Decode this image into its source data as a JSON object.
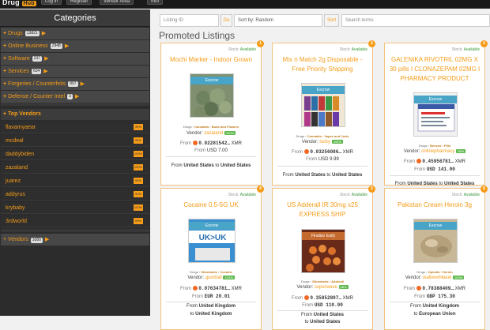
{
  "topbar": {
    "logo": "Drug",
    "logo_box": "Hub",
    "buttons": [
      "Log in",
      "Register",
      "Vendor Area",
      "Info"
    ]
  },
  "sidebar": {
    "title": "Categories",
    "categories": [
      {
        "label": "Drugs",
        "count": "13821"
      },
      {
        "label": "Online Business",
        "count": "2948"
      },
      {
        "label": "Software",
        "count": "237"
      },
      {
        "label": "Services",
        "count": "634"
      },
      {
        "label": "Forgeries / Counterfeits",
        "count": "897"
      },
      {
        "label": "Defense / Counter Intel",
        "count": "3"
      }
    ],
    "top_vendors_title": "Top Vendors",
    "vendors": [
      {
        "name": "flavamyaear",
        "pct": "99%"
      },
      {
        "name": "mcdeal",
        "pct": "98%"
      },
      {
        "name": "daddybiden",
        "pct": "100%"
      },
      {
        "name": "zazaland",
        "pct": "100%"
      },
      {
        "name": "juarez",
        "pct": "99%"
      },
      {
        "name": "addyrus",
        "pct": "99%"
      },
      {
        "name": "krybaby",
        "pct": "100%"
      },
      {
        "name": "3rdworld",
        "pct": "99%"
      }
    ],
    "vendors_row": {
      "label": "Vendors",
      "count": "1080"
    }
  },
  "search": {
    "listing_id_placeholder": "Listing ID",
    "go_label": "Go",
    "sort_label": "Sort by: Random",
    "sort_button": "Sort",
    "terms_placeholder": "Search terms"
  },
  "promoted_title": "Promoted Listings",
  "listings": [
    {
      "badge": "1",
      "stock": "Stock:",
      "available": "Available",
      "title": "Mochi Marker - Indoor Grown",
      "escrow": "Escrow",
      "crumb_pre": "Drugs ›",
      "crumb_a": "Cannabis ›",
      "crumb_b": "Buds and Flowers",
      "vendor_label": "Vendor:",
      "vendor": "zazaland",
      "vendor_pct": "100%",
      "from_label": "From",
      "price_crypto": "0.02281542…",
      "crypto": "XMR",
      "from2": "From",
      "price_fiat": "USD 7.00",
      "ship_from_label": "From",
      "ship_from": "United States",
      "ship_to_label": "to",
      "ship_to": "United States"
    },
    {
      "badge": "2",
      "stock": "Stock:",
      "available": "Available",
      "title": "Mix n Match 2g Disposable - Free Priority Shipping",
      "escrow": "Escrow",
      "crumb_pre": "Drugs ›",
      "crumb_a": "Cannabis ›",
      "crumb_b": "Vapes and Carts",
      "vendor_label": "Vendor:",
      "vendor": "lucky",
      "vendor_pct": "100%",
      "from_label": "From",
      "price_crypto": "0.03256086…",
      "crypto": "XMR",
      "from2": "From",
      "price_fiat": "USD 9.99",
      "ship_from_label": "From",
      "ship_from": "United States",
      "ship_to_label": "to",
      "ship_to": "United States"
    },
    {
      "badge": "3",
      "stock": "Stock:",
      "available": "Available",
      "title": "GALENIKA RIVOTRIL 02MG X 30 pills I CLONAZEPAM 02MG I PHARMACY PRODUCT",
      "escrow": "Escrow",
      "crumb_pre": "Drugs ›",
      "crumb_a": "Benzos ›",
      "crumb_b": "Pills",
      "vendor_label": "Vendor:",
      "vendor": "onlinepharmacy",
      "vendor_pct": "98%",
      "from_label": "From",
      "price_crypto": "0.45956781…",
      "crypto": "XMR",
      "from2": "From",
      "price_fiat": "USD 141.00",
      "ship_from_label": "From",
      "ship_from": "United States",
      "ship_to_label": "to",
      "ship_to": "United States"
    },
    {
      "badge": "4",
      "stock": "Stock:",
      "available": "Available",
      "title": "Cocaine 0.5-5G UK",
      "escrow": "Escrow",
      "crumb_pre": "Drugs ›",
      "crumb_a": "Stimulants ›",
      "crumb_b": "Cocaine",
      "vendor_label": "Vendor:",
      "vendor": "gumball",
      "vendor_pct": "100%",
      "from_label": "From",
      "price_crypto": "0.07634781…",
      "crypto": "XMR",
      "from2": "From",
      "price_fiat": "EUR 20.01",
      "ship_from_label": "From",
      "ship_from": "United Kingdom",
      "ship_to_label": "to",
      "ship_to": "United Kingdom"
    },
    {
      "badge": "5",
      "stock": "Stock:",
      "available": "Available",
      "title": "US Adderall IR 30mg x25 EXPRESS SHIP",
      "escrow": "Finalize Early",
      "crumb_pre": "Drugs ›",
      "crumb_a": "Stimulants ›",
      "crumb_b": "Adderall",
      "vendor_label": "Vendor:",
      "vendor": "superwave",
      "vendor_pct": "98%",
      "from_label": "From",
      "price_crypto": "0.35852807…",
      "crypto": "XMR",
      "from2": "From",
      "price_fiat": "USD 110.00",
      "ship_from_label": "From",
      "ship_from": "United States",
      "ship_to_label": "to",
      "ship_to": "United States"
    },
    {
      "badge": "6",
      "stock": "Stock:",
      "available": "Available",
      "title": "Pakistan Cream Heroin 3g",
      "escrow": "Escrow",
      "crumb_pre": "Drugs ›",
      "crumb_a": "Opioids ›",
      "crumb_b": "Heroin",
      "vendor_label": "Vendor:",
      "vendor": "walterwhiteuk",
      "vendor_pct": "100%",
      "from_label": "From",
      "price_crypto": "0.78388409…",
      "crypto": "XMR",
      "from2": "From",
      "price_fiat": "GBP 175.30",
      "ship_from_label": "From",
      "ship_from": "United Kingdom",
      "ship_to_label": "to",
      "ship_to": "European Union"
    }
  ],
  "colors": {
    "accent": "#f59c18",
    "escrow": "#48a5c8",
    "finalize": "#c46a2f",
    "available": "#3c9a3c"
  }
}
